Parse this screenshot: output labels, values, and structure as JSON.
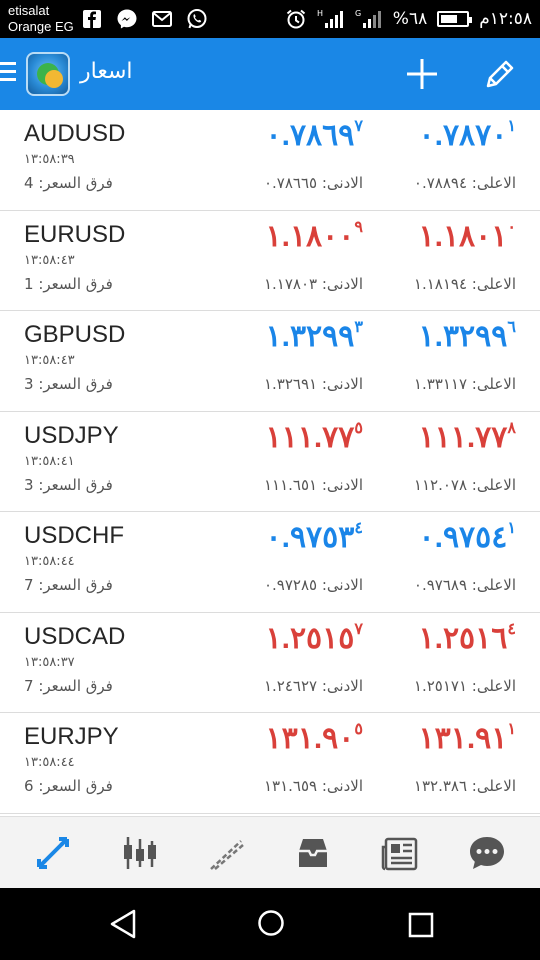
{
  "status_bar": {
    "carrier_line1": "etisalat",
    "carrier_line2": "Orange EG",
    "battery_text": "%٦٨",
    "battery_level": 0.68,
    "clock": "١٢:٥٨م"
  },
  "app_bar": {
    "title": "اسعار"
  },
  "quotes": [
    {
      "symbol": "AUDUSD",
      "time": "١٣:٥٨:٣٩",
      "spread": "فرق السعر: 4",
      "bid_main": "٠.٧٨٦٩",
      "bid_sup": "٧",
      "bid_dir": "up",
      "ask_main": "٠.٧٨٧٠",
      "ask_sup": "١",
      "ask_dir": "up",
      "low": "الادنى: ٠.٧٨٦٦٥",
      "high": "الاعلى: ٠.٧٨٨٩٤"
    },
    {
      "symbol": "EURUSD",
      "time": "١٣:٥٨:٤٣",
      "spread": "فرق السعر: 1",
      "bid_main": "١.١٨٠٠",
      "bid_sup": "٩",
      "bid_dir": "down",
      "ask_main": "١.١٨٠١",
      "ask_sup": "٠",
      "ask_dir": "down",
      "low": "الادنى: ١.١٧٨٠٣",
      "high": "الاعلى: ١.١٨١٩٤"
    },
    {
      "symbol": "GBPUSD",
      "time": "١٣:٥٨:٤٣",
      "spread": "فرق السعر: 3",
      "bid_main": "١.٣٢٩٩",
      "bid_sup": "٣",
      "bid_dir": "up",
      "ask_main": "١.٣٢٩٩",
      "ask_sup": "٦",
      "ask_dir": "up",
      "low": "الادنى: ١.٣٢٦٩١",
      "high": "الاعلى: ١.٣٣١١٧"
    },
    {
      "symbol": "USDJPY",
      "time": "١٣:٥٨:٤١",
      "spread": "فرق السعر: 3",
      "bid_main": "١١١.٧٧",
      "bid_sup": "٥",
      "bid_dir": "down",
      "ask_main": "١١١.٧٧",
      "ask_sup": "٨",
      "ask_dir": "down",
      "low": "الادنى: ١١١.٦٥١",
      "high": "الاعلى: ١١٢.٠٧٨"
    },
    {
      "symbol": "USDCHF",
      "time": "١٣:٥٨:٤٤",
      "spread": "فرق السعر: 7",
      "bid_main": "٠.٩٧٥٣",
      "bid_sup": "٤",
      "bid_dir": "up",
      "ask_main": "٠.٩٧٥٤",
      "ask_sup": "١",
      "ask_dir": "up",
      "low": "الادنى: ٠.٩٧٢٨٥",
      "high": "الاعلى: ٠.٩٧٦٨٩"
    },
    {
      "symbol": "USDCAD",
      "time": "١٣:٥٨:٣٧",
      "spread": "فرق السعر: 7",
      "bid_main": "١.٢٥١٥",
      "bid_sup": "٧",
      "bid_dir": "down",
      "ask_main": "١.٢٥١٦",
      "ask_sup": "٤",
      "ask_dir": "down",
      "low": "الادنى: ١.٢٤٦٢٧",
      "high": "الاعلى: ١.٢٥١٧١"
    },
    {
      "symbol": "EURJPY",
      "time": "١٣:٥٨:٤٤",
      "spread": "فرق السعر: 6",
      "bid_main": "١٣١.٩٠",
      "bid_sup": "٥",
      "bid_dir": "down",
      "ask_main": "١٣١.٩١",
      "ask_sup": "١",
      "ask_dir": "down",
      "low": "الادنى: ١٣١.٦٥٩",
      "high": "الاعلى: ١٣٢.٣٨٦"
    }
  ],
  "bottom_nav": [
    {
      "icon": "quotes-icon",
      "active": true
    },
    {
      "icon": "chart-icon",
      "active": false
    },
    {
      "icon": "trade-icon",
      "active": false
    },
    {
      "icon": "history-inbox-icon",
      "active": false
    },
    {
      "icon": "news-icon",
      "active": false
    },
    {
      "icon": "chat-icon",
      "active": false
    }
  ],
  "colors": {
    "accent": "#1a87e6",
    "price_up": "#1a85e8",
    "price_down": "#d9403a"
  }
}
